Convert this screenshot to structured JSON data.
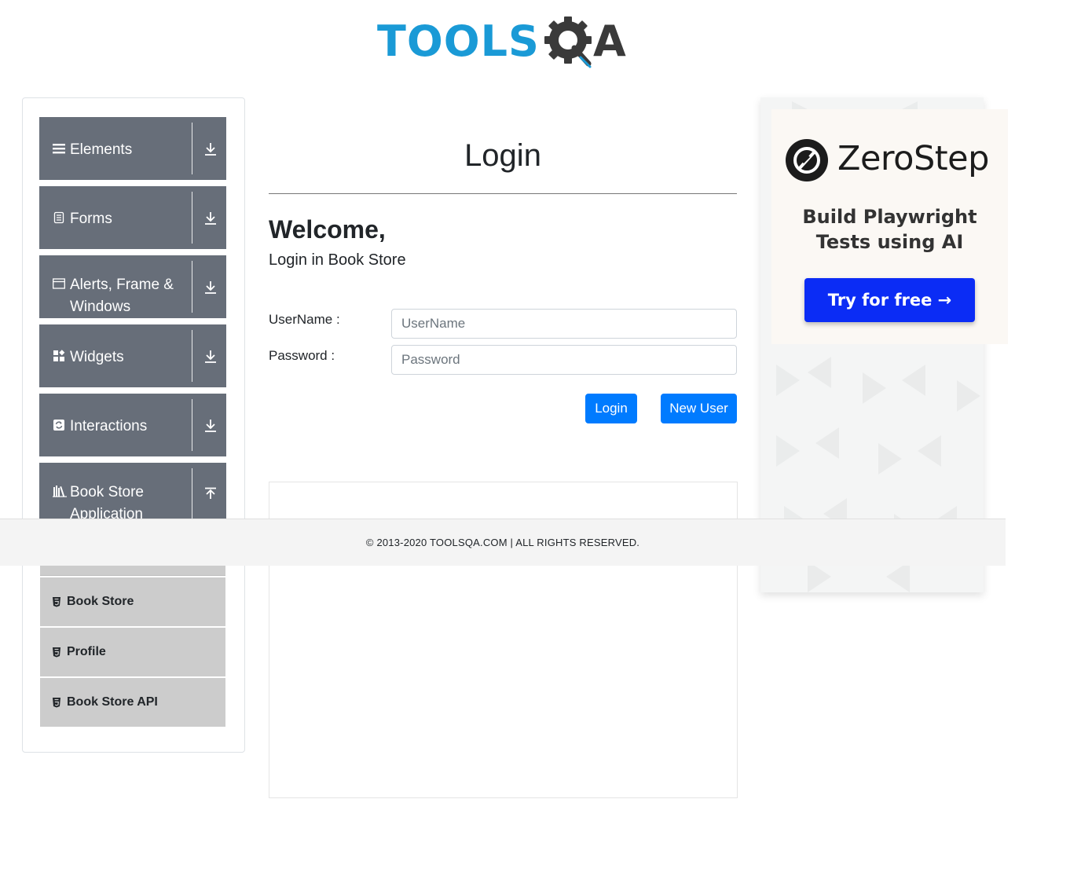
{
  "header": {
    "logo_text_primary": "TOOLS",
    "logo_text_secondary": "A",
    "logo_color_primary": "#1a9ad6",
    "logo_color_secondary": "#3a3a3a"
  },
  "sidebar": {
    "groups": [
      {
        "label": "Elements",
        "icon": "hamburger-icon",
        "arrow": "download-arrow-icon"
      },
      {
        "label": "Forms",
        "icon": "document-icon",
        "arrow": "download-arrow-icon"
      },
      {
        "label": "Alerts, Frame & Windows",
        "icon": "window-icon",
        "arrow": "download-arrow-icon"
      },
      {
        "label": "Widgets",
        "icon": "widgets-icon",
        "arrow": "download-arrow-icon"
      },
      {
        "label": "Interactions",
        "icon": "interactions-icon",
        "arrow": "download-arrow-icon"
      },
      {
        "label": "Book Store Application",
        "icon": "bookshelf-icon",
        "arrow": "upload-arrow-icon"
      }
    ],
    "sub_items": [
      {
        "label": "Book Store",
        "icon": "html5-shield-icon"
      },
      {
        "label": "Profile",
        "icon": "html5-shield-icon"
      },
      {
        "label": "Book Store API",
        "icon": "html5-shield-icon"
      }
    ],
    "group_color": "#676e79",
    "sub_item_color": "#cccccc"
  },
  "main": {
    "title": "Login",
    "welcome": "Welcome,",
    "subtitle": "Login in Book Store",
    "username_label": "UserName :",
    "username_placeholder": "UserName",
    "password_label": "Password :",
    "password_placeholder": "Password",
    "login_button": "Login",
    "new_user_button": "New User",
    "button_color": "#007bff"
  },
  "ad": {
    "brand": "ZeroStep",
    "tagline_line1": "Build Playwright",
    "tagline_line2": "Tests using AI",
    "cta": "Try for free →",
    "cta_color": "#0b2cf5"
  },
  "footer": {
    "text": "© 2013-2020 TOOLSQA.COM | ALL RIGHTS RESERVED."
  }
}
